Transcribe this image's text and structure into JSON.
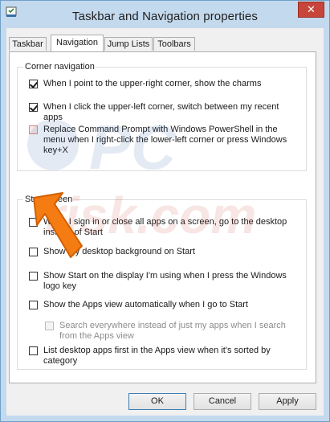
{
  "window": {
    "title": "Taskbar and Navigation properties",
    "close_glyph": "✕"
  },
  "tabs": [
    {
      "label": "Taskbar",
      "active": false
    },
    {
      "label": "Navigation",
      "active": true
    },
    {
      "label": "Jump Lists",
      "active": false
    },
    {
      "label": "Toolbars",
      "active": false
    }
  ],
  "corner_navigation": {
    "title": "Corner navigation",
    "options": [
      {
        "label": "When I point to the upper-right corner, show the charms",
        "checked": true
      },
      {
        "label": "When I click the upper-left corner, switch between my recent apps",
        "checked": true
      },
      {
        "label": "Replace Command Prompt with Windows PowerShell in the menu when I right-click the lower-left corner or press Windows key+X",
        "checked": false
      }
    ]
  },
  "start_screen": {
    "title": "Start screen",
    "options": [
      {
        "label": "When I sign in or close all apps on a screen, go to the desktop instead of Start",
        "checked": false
      },
      {
        "label": "Show my desktop background on Start",
        "checked": false
      },
      {
        "label": "Show Start on the display I'm using when I press the Windows logo key",
        "checked": false
      },
      {
        "label": "Show the Apps view automatically when I go to Start",
        "checked": false
      },
      {
        "label": "Search everywhere instead of just my apps when I search from the Apps view",
        "checked": false,
        "disabled": true
      },
      {
        "label": "List desktop apps first in the Apps view when it's sorted by category",
        "checked": false
      }
    ]
  },
  "buttons": {
    "ok": "OK",
    "cancel": "Cancel",
    "apply": "Apply"
  },
  "watermark_text": "PC risk.com",
  "colors": {
    "titlebar": "#c3d9ee",
    "close": "#c7453a",
    "arrow": "#f57c13"
  }
}
